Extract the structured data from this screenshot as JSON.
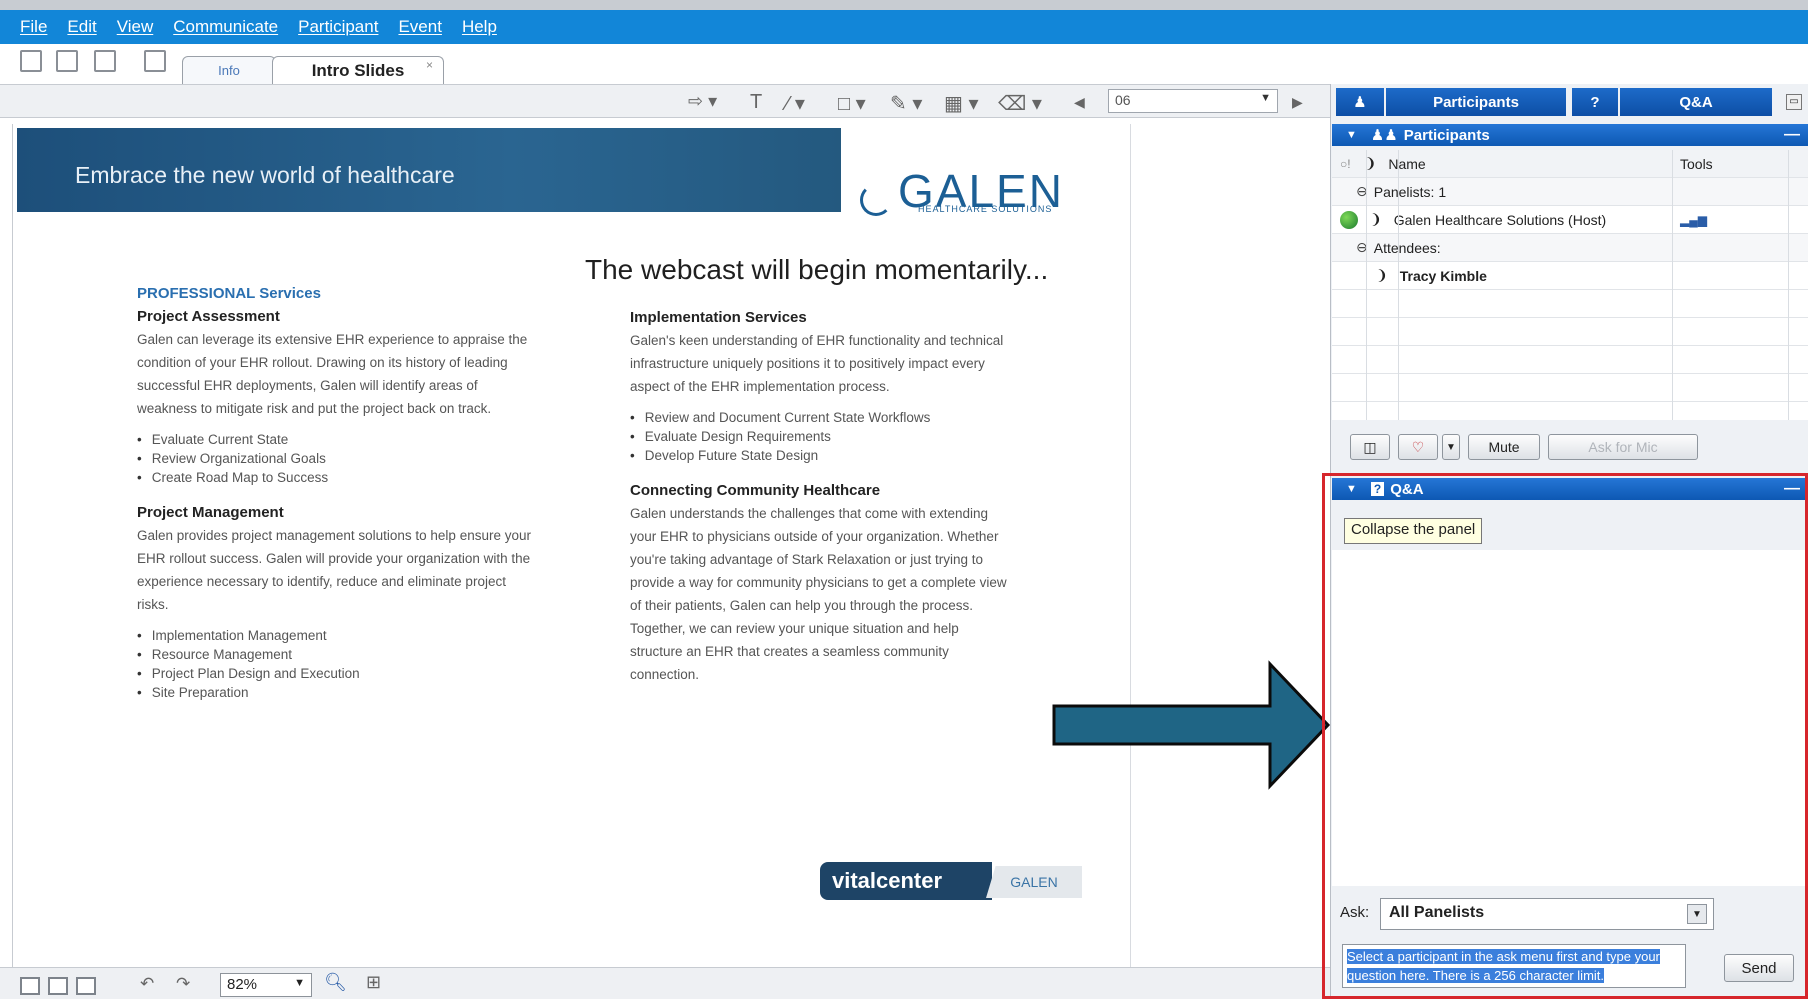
{
  "menu": [
    "File",
    "Edit",
    "View",
    "Communicate",
    "Participant",
    "Event",
    "Help"
  ],
  "tabs": {
    "info": "Info",
    "intro": "Intro Slides",
    "close": "×"
  },
  "slide_toolbar": {
    "slide_number": "06"
  },
  "slide": {
    "banner": "Embrace the new world of healthcare",
    "logo": "GALEN",
    "logo_sub": "HEALTHCARE SOLUTIONS",
    "headline": "The webcast will begin momentarily...",
    "left": {
      "section": "PROFESSIONAL Services",
      "h1": "Project Assessment",
      "p1": "Galen can leverage its extensive EHR experience to appraise the condition of your EHR rollout. Drawing on its history of leading successful EHR deployments, Galen will identify areas of weakness to mitigate risk and put the project back on track.",
      "b1": [
        "Evaluate Current State",
        "Review Organizational Goals",
        "Create Road Map to Success"
      ],
      "h2": "Project Management",
      "p2": "Galen provides project management solutions to help ensure your EHR rollout success. Galen will provide your organization with the experience necessary to identify, reduce and eliminate project risks.",
      "b2": [
        "Implementation Management",
        "Resource Management",
        "Project Plan Design and Execution",
        "Site Preparation"
      ]
    },
    "right": {
      "h1": "Implementation Services",
      "p1": "Galen's keen understanding of EHR functionality and technical infrastructure uniquely positions it to positively impact every aspect of the EHR implementation process.",
      "b1": [
        "Review and Document Current State Workflows",
        "Evaluate Design Requirements",
        "Develop Future State Design"
      ],
      "h2": "Connecting Community Healthcare",
      "p2": "Galen understands the challenges that come with extending your EHR to physicians outside of your organization. Whether you're taking advantage of Stark Relaxation or just trying to provide a way for community physicians to get a complete view of their patients, Galen can help you through the process. Together, we can review your unique situation and help structure an EHR that creates a seamless community connection."
    },
    "footer_logo": "vitalcenter",
    "footer_logo_galen": "GALEN"
  },
  "bottom": {
    "zoom": "82%"
  },
  "panel": {
    "tab_participants": "Participants",
    "tab_qa": "Q&A",
    "participants_header": "Participants",
    "col_name": "Name",
    "col_tools": "Tools",
    "panelists_group": "Panelists: 1",
    "host": "Galen Healthcare Solutions (Host)",
    "attendees_group": "Attendees:",
    "attendee": "Tracy Kimble",
    "mute": "Mute",
    "ask_for_mic": "Ask for Mic",
    "qa_header": "Q&A",
    "tooltip": "Collapse the panel",
    "ask_label": "Ask:",
    "ask_value": "All Panelists",
    "question_placeholder": "Select a participant in the ask menu first and type your question here. There is a 256 character limit.",
    "send": "Send"
  },
  "colors": {
    "menubar": "#1286d8",
    "banner": "#1d4f7a",
    "arrow": "#1f6585",
    "highlight_box": "#d6262c"
  }
}
